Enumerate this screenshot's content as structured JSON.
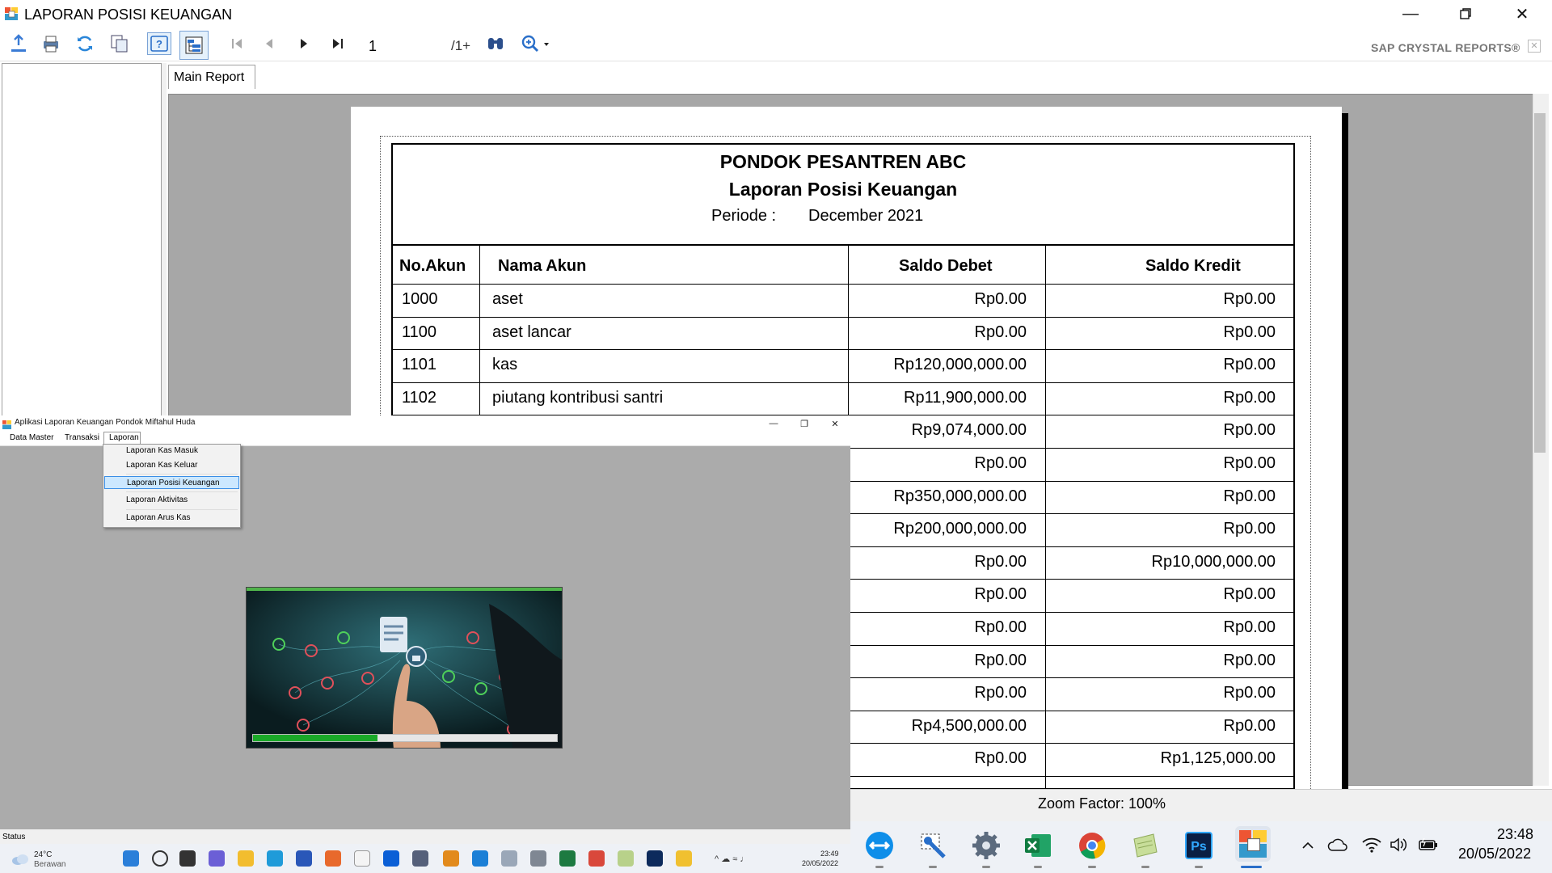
{
  "window": {
    "title": "LAPORAN POSISI KEUANGAN"
  },
  "toolbar": {
    "page_value": "1",
    "page_total": "/1+",
    "brand": "SAP CRYSTAL REPORTS®"
  },
  "tabs": {
    "main": "Main Report"
  },
  "report": {
    "company": "PONDOK PESANTREN ABC",
    "title": "Laporan Posisi Keuangan",
    "periode_label": "Periode :",
    "periode_value": "December 2021",
    "headers": [
      "No.Akun",
      "Nama Akun",
      "Saldo Debet",
      "Saldo Kredit"
    ],
    "rows": [
      {
        "no": "1000",
        "nama": "aset",
        "debet": "Rp0.00",
        "kredit": "Rp0.00"
      },
      {
        "no": "1100",
        "nama": "aset lancar",
        "debet": "Rp0.00",
        "kredit": "Rp0.00"
      },
      {
        "no": "1101",
        "nama": "kas",
        "debet": "Rp120,000,000.00",
        "kredit": "Rp0.00"
      },
      {
        "no": "1102",
        "nama": "piutang kontribusi santri",
        "debet": "Rp11,900,000.00",
        "kredit": "Rp0.00"
      },
      {
        "no": "",
        "nama": "",
        "debet": "Rp9,074,000.00",
        "kredit": "Rp0.00"
      },
      {
        "no": "",
        "nama": "",
        "debet": "Rp0.00",
        "kredit": "Rp0.00"
      },
      {
        "no": "",
        "nama": "",
        "debet": "Rp350,000,000.00",
        "kredit": "Rp0.00"
      },
      {
        "no": "",
        "nama": "",
        "debet": "Rp200,000,000.00",
        "kredit": "Rp0.00"
      },
      {
        "no": "",
        "nama": "",
        "debet": "Rp0.00",
        "kredit": "Rp10,000,000.00"
      },
      {
        "no": "",
        "nama": "",
        "debet": "Rp0.00",
        "kredit": "Rp0.00"
      },
      {
        "no": "",
        "nama": "",
        "debet": "Rp0.00",
        "kredit": "Rp0.00"
      },
      {
        "no": "",
        "nama": "",
        "debet": "Rp0.00",
        "kredit": "Rp0.00"
      },
      {
        "no": "",
        "nama": "",
        "debet": "Rp0.00",
        "kredit": "Rp0.00"
      },
      {
        "no": "",
        "nama": "",
        "debet": "Rp4,500,000.00",
        "kredit": "Rp0.00"
      },
      {
        "no": "",
        "nama": "",
        "debet": "Rp0.00",
        "kredit": "Rp1,125,000.00"
      }
    ]
  },
  "statusbar": {
    "zoom": "Zoom Factor: 100%"
  },
  "app": {
    "title": "Aplikasi Laporan Keuangan Pondok Miftahul Huda",
    "menu": [
      "Data Master",
      "Transaksi",
      "Laporan"
    ],
    "laporan_items": [
      "Laporan Kas Masuk",
      "Laporan Kas Keluar",
      "Laporan Posisi Keuangan",
      "Laporan Aktivitas",
      "Laporan Arus Kas"
    ],
    "status": "Status",
    "splash_progress": 0.41
  },
  "mini_taskbar": {
    "temp": "24°C",
    "weather": "Berawan",
    "time": "23:49",
    "date": "20/05/2022"
  },
  "taskbar": {
    "time": "23:48",
    "date": "20/05/2022"
  },
  "colors": {
    "accent": "#1aa928",
    "selection": "#cce8ff",
    "viewer_bg": "#a7a7a7"
  }
}
